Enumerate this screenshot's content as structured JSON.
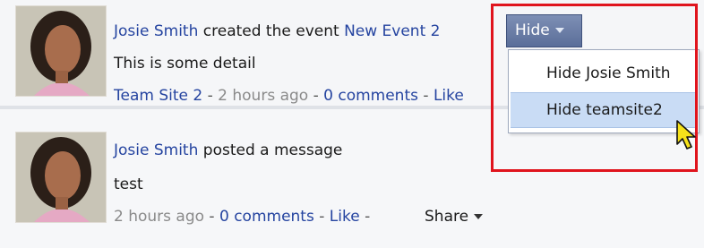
{
  "feed": {
    "items": [
      {
        "author": "Josie Smith",
        "action": " created the event ",
        "target": "New Event 2",
        "detail": "This is some detail",
        "site": "Team Site 2",
        "dash1": " - ",
        "time": "2 hours ago",
        "dash2": " - ",
        "comments": "0 comments",
        "dash3": " - ",
        "like": "Like"
      },
      {
        "author": "Josie Smith",
        "action": " posted a message",
        "detail": "test",
        "time": "2 hours ago",
        "dash1": " - ",
        "comments": "0 comments",
        "dash2": " - ",
        "like": "Like",
        "dash3": " -",
        "share": "Share"
      }
    ]
  },
  "hide_menu": {
    "button_label": "Hide",
    "options": [
      "Hide Josie Smith",
      "Hide teamsite2"
    ],
    "highlighted_index": 1
  },
  "colors": {
    "link": "#2544a0",
    "highlight_box": "#e0141d",
    "button": "#5a6e99",
    "hover_item": "#c9dcf5"
  },
  "icons": [
    "chevron-down-icon",
    "mouse-pointer-icon"
  ]
}
